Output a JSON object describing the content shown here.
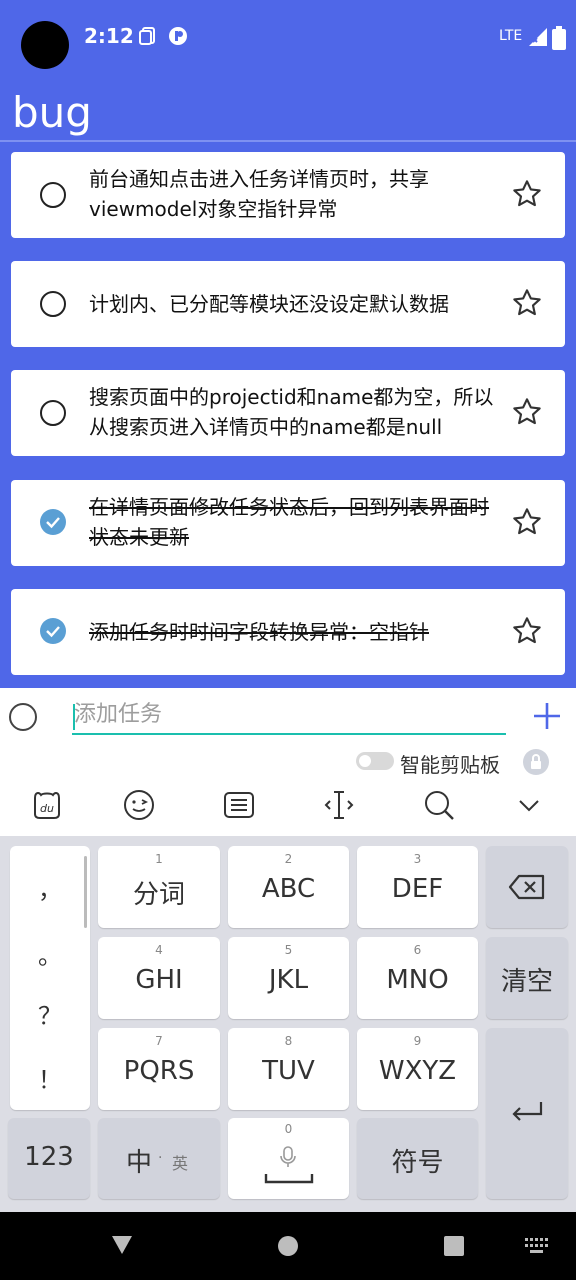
{
  "status": {
    "time": "2:12",
    "network": "LTE"
  },
  "app": {
    "title": "bug"
  },
  "tasks": [
    {
      "text": "前台通知点击进入任务详情页时，共享viewmodel对象空指针异常",
      "done": false
    },
    {
      "text": "计划内、已分配等模块还没设定默认数据",
      "done": false
    },
    {
      "text": "搜索页面中的projectid和name都为空，所以从搜索页进入详情页中的name都是null",
      "done": false
    },
    {
      "text": "在详情页面修改任务状态后，回到列表界面时状态未更新",
      "done": true
    },
    {
      "text": "添加任务时时间字段转换异常：空指针",
      "done": true
    }
  ],
  "add_task": {
    "placeholder": "添加任务",
    "value": ""
  },
  "keyboard": {
    "smart_clipboard_label": "智能剪贴板",
    "toolbar_icons": [
      "du-logo-icon",
      "emoji-icon",
      "keyboard-icon",
      "cursor-icon",
      "search-icon",
      "chevron-down-icon"
    ],
    "punctuation": [
      "，",
      "。",
      "？",
      "！"
    ],
    "keys": [
      {
        "num": "1",
        "label": "分词"
      },
      {
        "num": "2",
        "label": "ABC"
      },
      {
        "num": "3",
        "label": "DEF"
      },
      {
        "num": "4",
        "label": "GHI"
      },
      {
        "num": "5",
        "label": "JKL"
      },
      {
        "num": "6",
        "label": "MNO"
      },
      {
        "num": "7",
        "label": "PQRS"
      },
      {
        "num": "8",
        "label": "TUV"
      },
      {
        "num": "9",
        "label": "WXYZ"
      }
    ],
    "clear_label": "清空",
    "num_label": "123",
    "lang_main": "中",
    "lang_alt": "英",
    "space_num": "0",
    "symbol_label": "符号"
  },
  "colors": {
    "accent": "#4f67e8",
    "check": "#5a9fd4",
    "input_line": "#1abfae"
  }
}
